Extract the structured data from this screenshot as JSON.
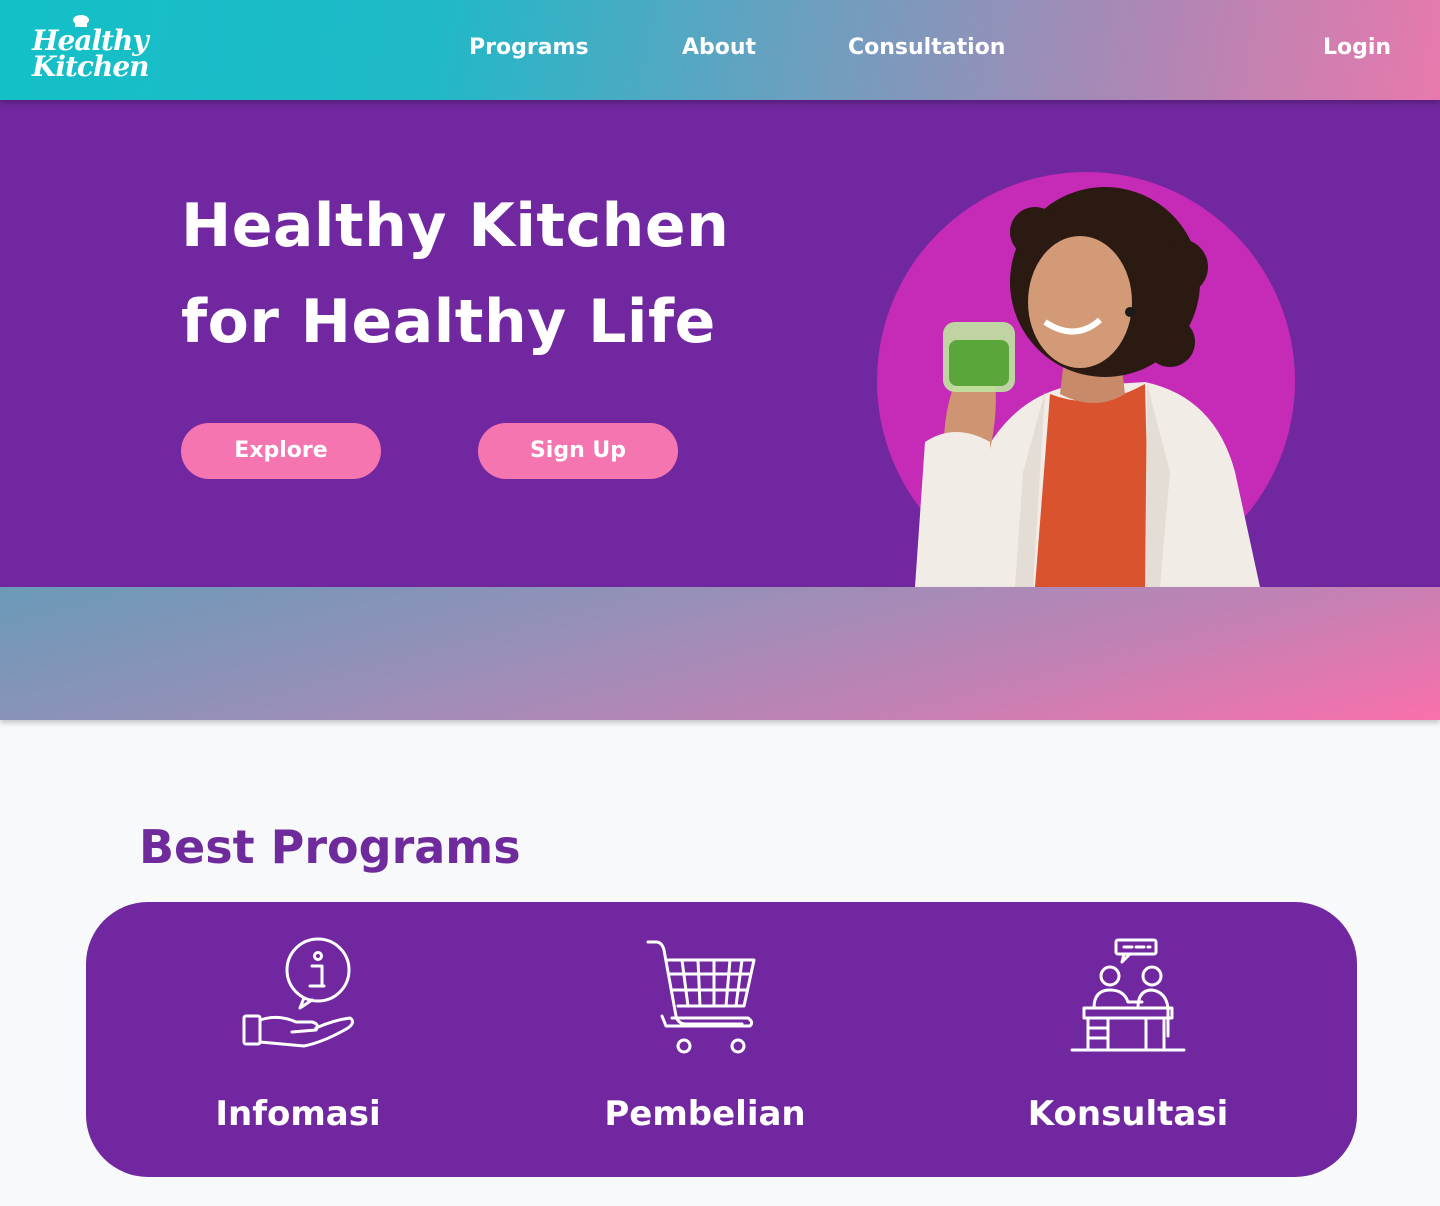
{
  "header": {
    "logo": {
      "line1": "Healthy",
      "line2": "Kitchen"
    },
    "nav": {
      "programs": "Programs",
      "about": "About",
      "consultation": "Consultation",
      "login": "Login"
    }
  },
  "hero": {
    "title_line1": "Healthy Kitchen",
    "title_line2": "for Healthy Life",
    "explore_label": "Explore",
    "signup_label": "Sign Up"
  },
  "programs": {
    "title": "Best Programs",
    "items": [
      {
        "label": "Infomasi",
        "icon": "info-hand-icon"
      },
      {
        "label": "Pembelian",
        "icon": "shopping-cart-icon"
      },
      {
        "label": "Konsultasi",
        "icon": "consultation-icon"
      }
    ]
  },
  "colors": {
    "primary_purple": "#7027a0",
    "accent_pink": "#f575b0",
    "circle_magenta": "#c52bb6",
    "header_teal": "#1fb9c8"
  }
}
